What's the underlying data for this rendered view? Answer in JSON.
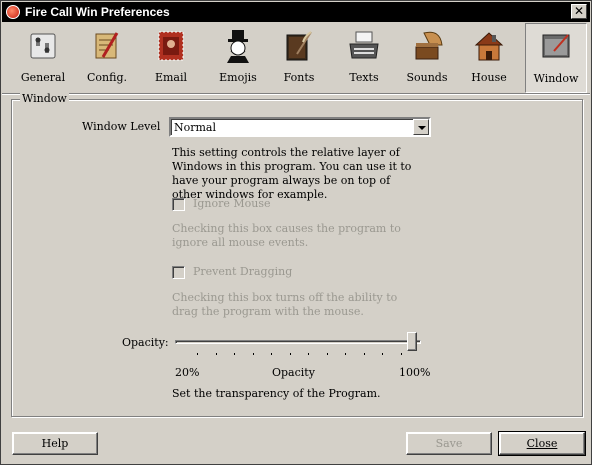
{
  "window": {
    "title": "Fire Call Win Preferences",
    "close_glyph": "✕"
  },
  "toolbar": {
    "items": [
      {
        "label": "General",
        "icon": "switches-icon"
      },
      {
        "label": "Config.",
        "icon": "pencil-scroll-icon"
      },
      {
        "label": "Email",
        "icon": "stamp-icon"
      },
      {
        "label": "Emojis",
        "icon": "monopoly-man-icon"
      },
      {
        "label": "Fonts",
        "icon": "book-quill-icon"
      },
      {
        "label": "Texts",
        "icon": "typewriter-icon"
      },
      {
        "label": "Sounds",
        "icon": "gramophone-icon"
      },
      {
        "label": "House",
        "icon": "house-icon"
      },
      {
        "label": "Window",
        "icon": "window-icon"
      }
    ],
    "selected": "Window"
  },
  "group": {
    "legend": "Window",
    "window_level_label": "Window Level",
    "window_level_value": "Normal",
    "window_level_help": "This setting controls the relative layer of Windows in this program. You can use it to have your program always be on top of other windows for example.",
    "ignore_mouse_label": "Ignore Mouse",
    "ignore_mouse_help": "Checking this box causes the program to ignore all mouse events.",
    "prevent_dragging_label": "Prevent Dragging",
    "prevent_dragging_help": "Checking this box turns off the ability to drag the program with the mouse.",
    "opacity_label": "Opacity:",
    "opacity_value_percent": 100,
    "opacity_min_label": "20%",
    "opacity_mid_label": "Opacity",
    "opacity_max_label": "100%",
    "opacity_help": "Set the transparency of the Program."
  },
  "buttons": {
    "help": "Help",
    "save": "Save",
    "close": "Close"
  }
}
